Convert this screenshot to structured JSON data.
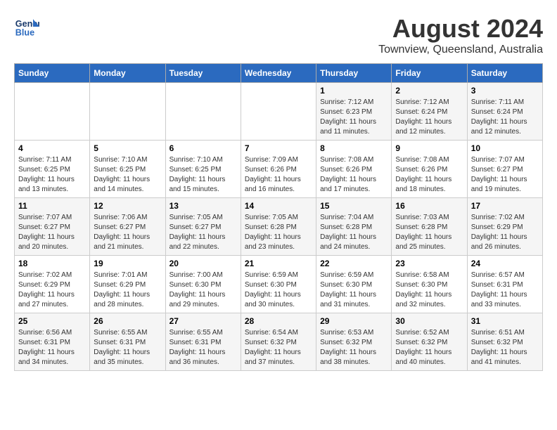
{
  "header": {
    "logo_line1": "General",
    "logo_line2": "Blue",
    "main_title": "August 2024",
    "subtitle": "Townview, Queensland, Australia"
  },
  "calendar": {
    "days_of_week": [
      "Sunday",
      "Monday",
      "Tuesday",
      "Wednesday",
      "Thursday",
      "Friday",
      "Saturday"
    ],
    "weeks": [
      [
        {
          "day": "",
          "info": ""
        },
        {
          "day": "",
          "info": ""
        },
        {
          "day": "",
          "info": ""
        },
        {
          "day": "",
          "info": ""
        },
        {
          "day": "1",
          "info": "Sunrise: 7:12 AM\nSunset: 6:23 PM\nDaylight: 11 hours and 11 minutes."
        },
        {
          "day": "2",
          "info": "Sunrise: 7:12 AM\nSunset: 6:24 PM\nDaylight: 11 hours and 12 minutes."
        },
        {
          "day": "3",
          "info": "Sunrise: 7:11 AM\nSunset: 6:24 PM\nDaylight: 11 hours and 12 minutes."
        }
      ],
      [
        {
          "day": "4",
          "info": "Sunrise: 7:11 AM\nSunset: 6:25 PM\nDaylight: 11 hours and 13 minutes."
        },
        {
          "day": "5",
          "info": "Sunrise: 7:10 AM\nSunset: 6:25 PM\nDaylight: 11 hours and 14 minutes."
        },
        {
          "day": "6",
          "info": "Sunrise: 7:10 AM\nSunset: 6:25 PM\nDaylight: 11 hours and 15 minutes."
        },
        {
          "day": "7",
          "info": "Sunrise: 7:09 AM\nSunset: 6:26 PM\nDaylight: 11 hours and 16 minutes."
        },
        {
          "day": "8",
          "info": "Sunrise: 7:08 AM\nSunset: 6:26 PM\nDaylight: 11 hours and 17 minutes."
        },
        {
          "day": "9",
          "info": "Sunrise: 7:08 AM\nSunset: 6:26 PM\nDaylight: 11 hours and 18 minutes."
        },
        {
          "day": "10",
          "info": "Sunrise: 7:07 AM\nSunset: 6:27 PM\nDaylight: 11 hours and 19 minutes."
        }
      ],
      [
        {
          "day": "11",
          "info": "Sunrise: 7:07 AM\nSunset: 6:27 PM\nDaylight: 11 hours and 20 minutes."
        },
        {
          "day": "12",
          "info": "Sunrise: 7:06 AM\nSunset: 6:27 PM\nDaylight: 11 hours and 21 minutes."
        },
        {
          "day": "13",
          "info": "Sunrise: 7:05 AM\nSunset: 6:27 PM\nDaylight: 11 hours and 22 minutes."
        },
        {
          "day": "14",
          "info": "Sunrise: 7:05 AM\nSunset: 6:28 PM\nDaylight: 11 hours and 23 minutes."
        },
        {
          "day": "15",
          "info": "Sunrise: 7:04 AM\nSunset: 6:28 PM\nDaylight: 11 hours and 24 minutes."
        },
        {
          "day": "16",
          "info": "Sunrise: 7:03 AM\nSunset: 6:28 PM\nDaylight: 11 hours and 25 minutes."
        },
        {
          "day": "17",
          "info": "Sunrise: 7:02 AM\nSunset: 6:29 PM\nDaylight: 11 hours and 26 minutes."
        }
      ],
      [
        {
          "day": "18",
          "info": "Sunrise: 7:02 AM\nSunset: 6:29 PM\nDaylight: 11 hours and 27 minutes."
        },
        {
          "day": "19",
          "info": "Sunrise: 7:01 AM\nSunset: 6:29 PM\nDaylight: 11 hours and 28 minutes."
        },
        {
          "day": "20",
          "info": "Sunrise: 7:00 AM\nSunset: 6:30 PM\nDaylight: 11 hours and 29 minutes."
        },
        {
          "day": "21",
          "info": "Sunrise: 6:59 AM\nSunset: 6:30 PM\nDaylight: 11 hours and 30 minutes."
        },
        {
          "day": "22",
          "info": "Sunrise: 6:59 AM\nSunset: 6:30 PM\nDaylight: 11 hours and 31 minutes."
        },
        {
          "day": "23",
          "info": "Sunrise: 6:58 AM\nSunset: 6:30 PM\nDaylight: 11 hours and 32 minutes."
        },
        {
          "day": "24",
          "info": "Sunrise: 6:57 AM\nSunset: 6:31 PM\nDaylight: 11 hours and 33 minutes."
        }
      ],
      [
        {
          "day": "25",
          "info": "Sunrise: 6:56 AM\nSunset: 6:31 PM\nDaylight: 11 hours and 34 minutes."
        },
        {
          "day": "26",
          "info": "Sunrise: 6:55 AM\nSunset: 6:31 PM\nDaylight: 11 hours and 35 minutes."
        },
        {
          "day": "27",
          "info": "Sunrise: 6:55 AM\nSunset: 6:31 PM\nDaylight: 11 hours and 36 minutes."
        },
        {
          "day": "28",
          "info": "Sunrise: 6:54 AM\nSunset: 6:32 PM\nDaylight: 11 hours and 37 minutes."
        },
        {
          "day": "29",
          "info": "Sunrise: 6:53 AM\nSunset: 6:32 PM\nDaylight: 11 hours and 38 minutes."
        },
        {
          "day": "30",
          "info": "Sunrise: 6:52 AM\nSunset: 6:32 PM\nDaylight: 11 hours and 40 minutes."
        },
        {
          "day": "31",
          "info": "Sunrise: 6:51 AM\nSunset: 6:32 PM\nDaylight: 11 hours and 41 minutes."
        }
      ]
    ]
  }
}
